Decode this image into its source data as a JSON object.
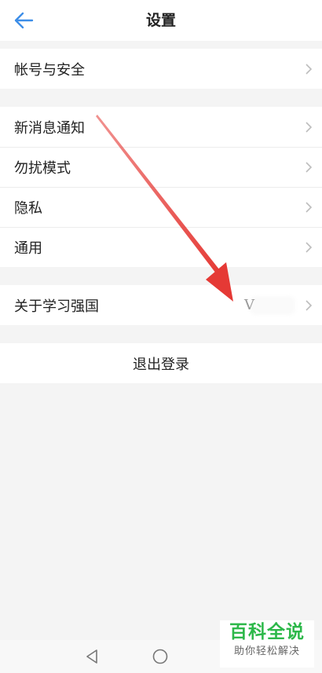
{
  "header": {
    "title": "设置",
    "back_icon": "arrow-left-icon",
    "accent_color": "#3d8ee8"
  },
  "groups": [
    {
      "items": [
        {
          "label": "帐号与安全"
        }
      ]
    },
    {
      "items": [
        {
          "label": "新消息通知"
        },
        {
          "label": "勿扰模式"
        },
        {
          "label": "隐私"
        },
        {
          "label": "通用"
        }
      ]
    },
    {
      "items": [
        {
          "label": "关于学习强国",
          "value": "V"
        }
      ]
    }
  ],
  "logout": {
    "label": "退出登录"
  },
  "annotation": {
    "color": "#e53935"
  },
  "watermark": {
    "title": "百科全说",
    "subtitle": "助你轻松解决",
    "color": "#2db84a"
  },
  "navbar": {
    "icons": [
      "back-triangle-icon",
      "home-circle-icon"
    ]
  }
}
